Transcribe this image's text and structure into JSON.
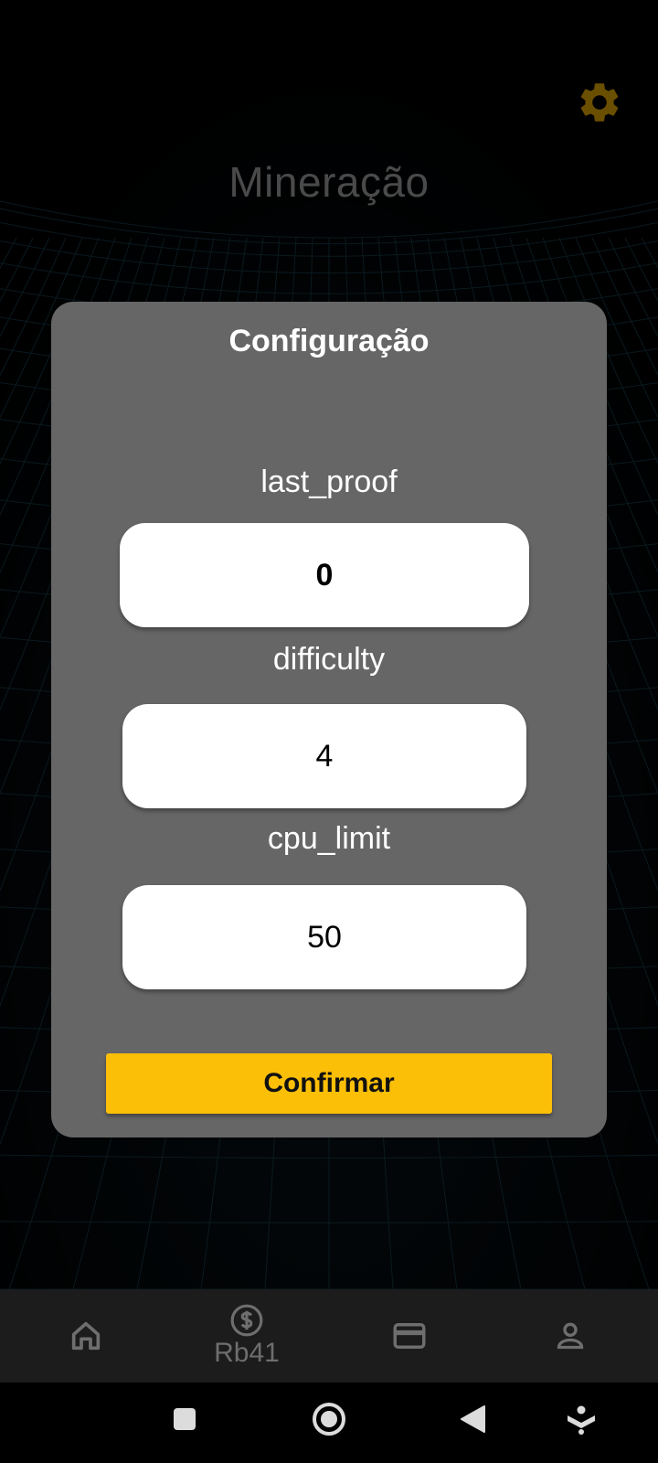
{
  "header": {
    "title": "Mineração",
    "settings_icon": "gear-icon",
    "accent_color": "#fbbf07"
  },
  "dialog": {
    "title": "Configuração",
    "fields": [
      {
        "label": "last_proof",
        "value": "0"
      },
      {
        "label": "difficulty",
        "value": "4"
      },
      {
        "label": "cpu_limit",
        "value": "50"
      }
    ],
    "confirm_label": "Confirmar"
  },
  "bottom_nav": {
    "items": [
      {
        "icon": "home-icon",
        "label": ""
      },
      {
        "icon": "dollar-circle-icon",
        "label": "Rb41"
      },
      {
        "icon": "credit-card-icon",
        "label": ""
      },
      {
        "icon": "user-icon",
        "label": ""
      }
    ]
  },
  "system_nav": {
    "items": [
      "recents-square-icon",
      "home-circle-icon",
      "back-triangle-icon",
      "assistant-icon"
    ]
  }
}
